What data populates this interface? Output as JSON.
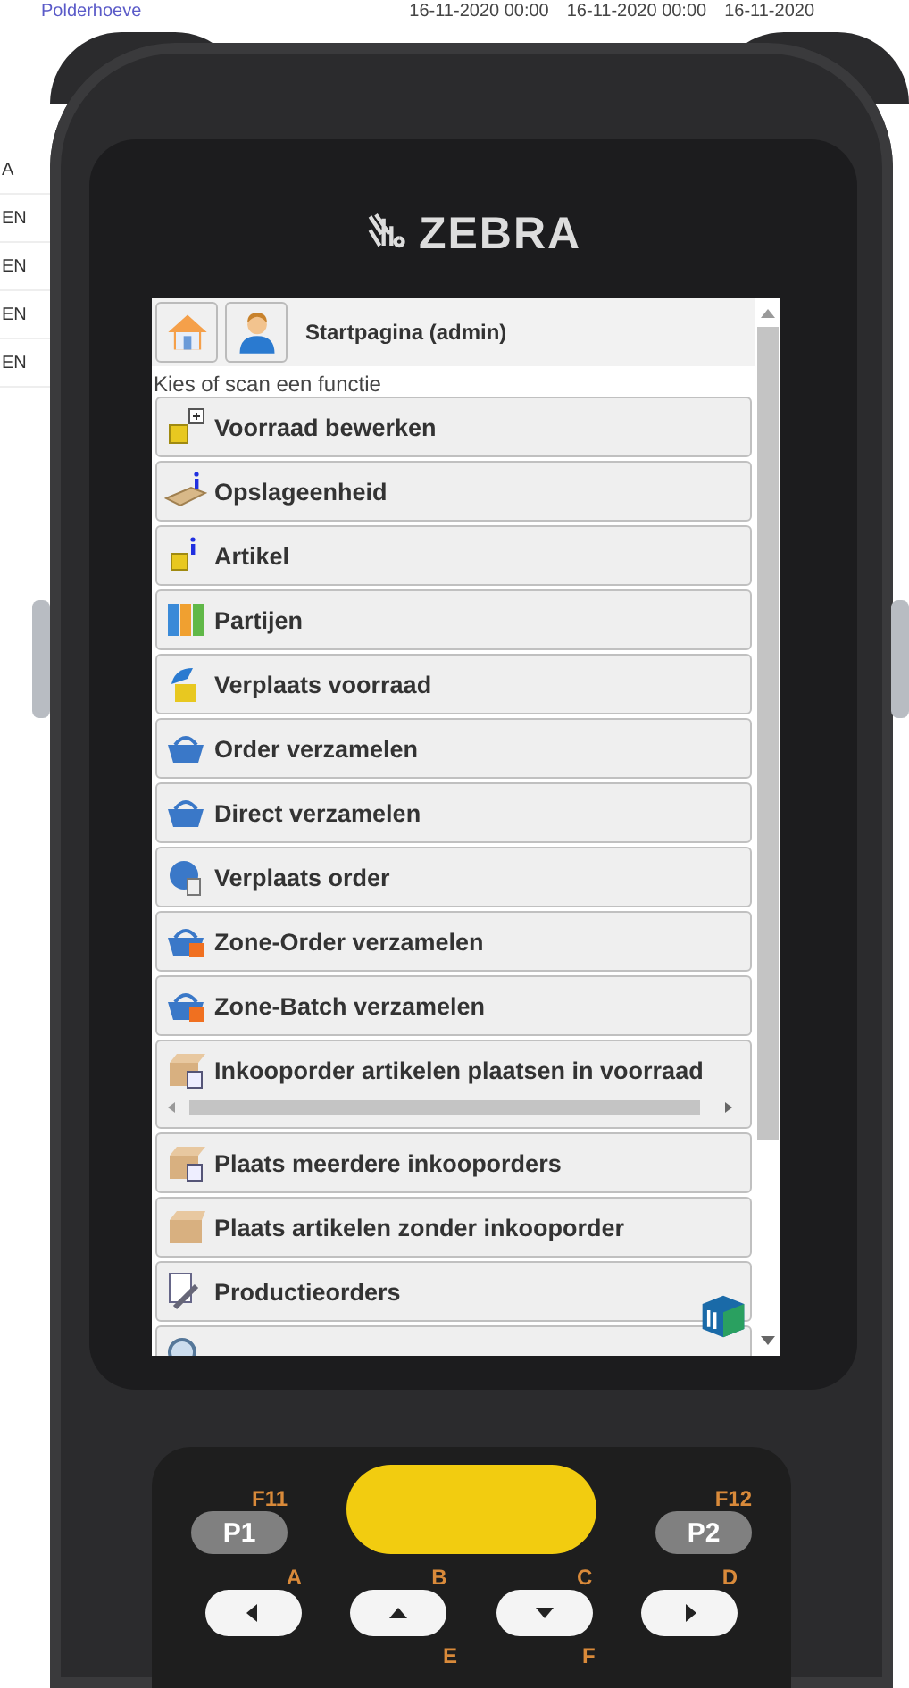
{
  "background_page": {
    "link": "Polderhoeve",
    "dates": [
      "16-11-2020 00:00",
      "16-11-2020 00:00",
      "16-11-2020"
    ],
    "row_fragments": [
      "A",
      "EN",
      "EN",
      "EN",
      "EN"
    ]
  },
  "device": {
    "brand": "ZEBRA",
    "screen": {
      "title": "Startpagina (admin)",
      "subtitle": "Kies of scan een functie",
      "menu_items": [
        {
          "label": "Voorraad bewerken",
          "overflow": false
        },
        {
          "label": "Opslageenheid",
          "overflow": false
        },
        {
          "label": "Artikel",
          "overflow": false
        },
        {
          "label": "Partijen",
          "overflow": false
        },
        {
          "label": "Verplaats voorraad",
          "overflow": false
        },
        {
          "label": "Order verzamelen",
          "overflow": false
        },
        {
          "label": "Direct verzamelen",
          "overflow": false
        },
        {
          "label": "Verplaats order",
          "overflow": false
        },
        {
          "label": "Zone-Order verzamelen",
          "overflow": false
        },
        {
          "label": "Zone-Batch verzamelen",
          "overflow": false
        },
        {
          "label": "Inkooporder artikelen plaatsen in voorraad",
          "overflow": true
        },
        {
          "label": "Plaats meerdere inkooporders",
          "overflow": false
        },
        {
          "label": "Plaats artikelen zonder inkooporder",
          "overflow": false
        },
        {
          "label": "Productieorders",
          "overflow": false
        }
      ]
    },
    "keypad": {
      "function_keys": [
        {
          "key": "P1",
          "label": "F11"
        },
        {
          "key": "P2",
          "label": "F12"
        }
      ],
      "arrow_keys": [
        {
          "label": "A",
          "kind": "left"
        },
        {
          "label": "B",
          "kind": "up"
        },
        {
          "label": "C",
          "kind": "down"
        },
        {
          "label": "D",
          "kind": "right"
        }
      ],
      "lower_labels": [
        "E",
        "F"
      ]
    }
  }
}
